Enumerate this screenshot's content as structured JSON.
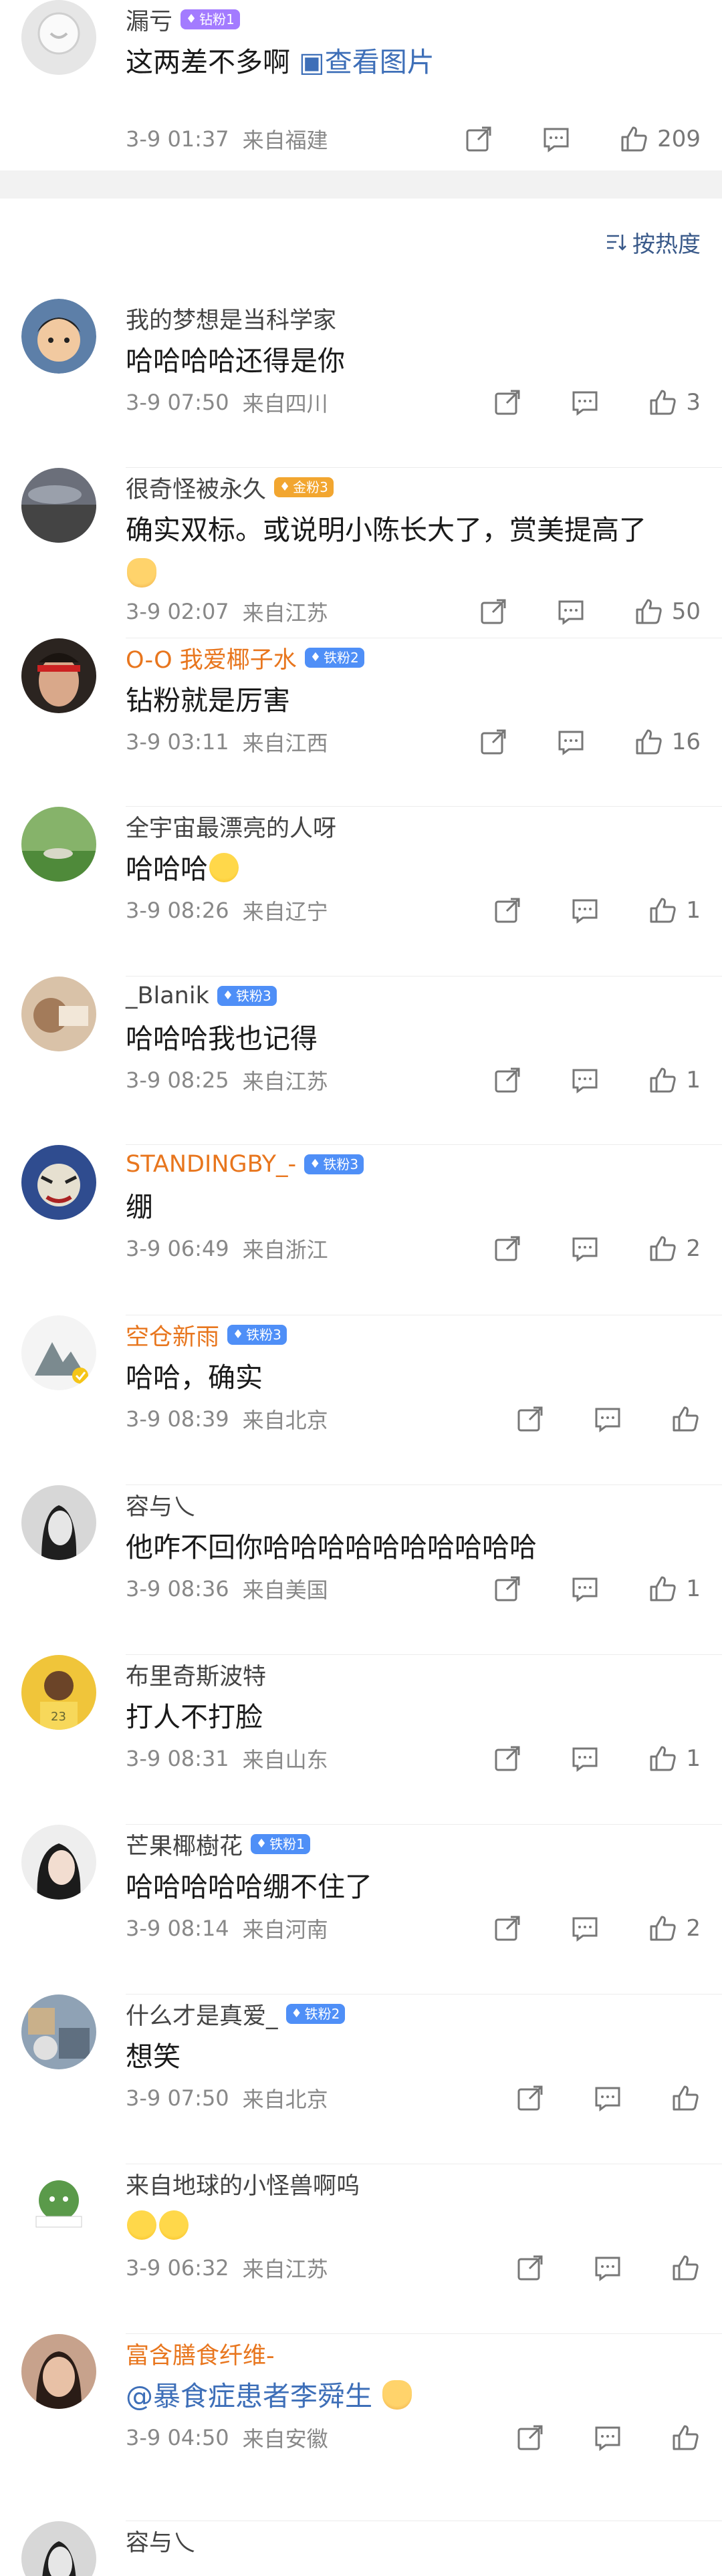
{
  "top": {
    "name": "漏亏",
    "badge": "钻粉1",
    "content": "这两差不多啊",
    "gallery": "查看图片",
    "time": "3-9 01:37",
    "location": "来自福建",
    "likes": "209"
  },
  "sort_label": "按热度",
  "comments": [
    {
      "name": "我的梦想是当科学家",
      "badge": "",
      "content": "哈哈哈哈还得是你",
      "time": "3-9 07:50",
      "location": "来自四川",
      "likes": "3"
    },
    {
      "name": "很奇怪被永久",
      "badge": "金粉3",
      "content": "确实双标。或说明小陈长大了，赏美提高了",
      "time": "3-9 02:07",
      "location": "来自江苏",
      "likes": "50"
    },
    {
      "name": "O-O 我爱椰子水",
      "badge": "铁粉2",
      "content": "钻粉就是厉害",
      "time": "3-9 03:11",
      "location": "来自江西",
      "likes": "16"
    },
    {
      "name": "全宇宙最漂亮的人呀",
      "badge": "",
      "content": "哈哈哈",
      "time": "3-9 08:26",
      "location": "来自辽宁",
      "likes": "1"
    },
    {
      "name": "_Blanik",
      "badge": "铁粉3",
      "content": "哈哈哈我也记得",
      "time": "3-9 08:25",
      "location": "来自江苏",
      "likes": "1"
    },
    {
      "name": "STANDINGBY_-",
      "badge": "铁粉3",
      "content": "绷",
      "time": "3-9 06:49",
      "location": "来自浙江",
      "likes": "2"
    },
    {
      "name": "空仓新雨",
      "badge": "铁粉3",
      "content": "哈哈，确实",
      "time": "3-9 08:39",
      "location": "来自北京",
      "likes": ""
    },
    {
      "name": "容与乀",
      "badge": "",
      "content": "他咋不回你哈哈哈哈哈哈哈哈哈哈",
      "time": "3-9 08:36",
      "location": "来自美国",
      "likes": "1"
    },
    {
      "name": "布里奇斯波特",
      "badge": "",
      "content": "打人不打脸",
      "time": "3-9 08:31",
      "location": "来自山东",
      "likes": "1"
    },
    {
      "name": "芒果椰樹花",
      "badge": "铁粉1",
      "content": "哈哈哈哈哈绷不住了",
      "time": "3-9 08:14",
      "location": "来自河南",
      "likes": "2"
    },
    {
      "name": "什么才是真爱_",
      "badge": "铁粉2",
      "content": "想笑",
      "time": "3-9 07:50",
      "location": "来自北京",
      "likes": ""
    },
    {
      "name": "来自地球的小怪兽啊呜",
      "badge": "",
      "content": "",
      "time": "3-9 06:32",
      "location": "来自江苏",
      "likes": ""
    },
    {
      "name": "富含膳食纤维-",
      "badge": "",
      "content": "@暴食症患者李舜生",
      "time": "3-9 04:50",
      "location": "来自安徽",
      "likes": ""
    },
    {
      "name": "容与乀",
      "badge": "",
      "content": "",
      "time": "",
      "location": "",
      "likes": ""
    }
  ]
}
